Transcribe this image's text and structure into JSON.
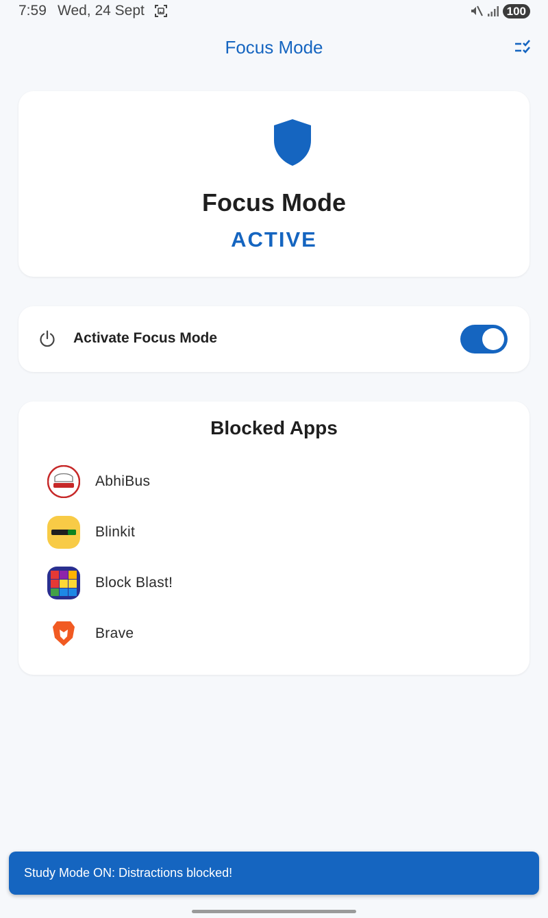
{
  "status_bar": {
    "time": "7:59",
    "date": "Wed, 24 Sept",
    "battery": "100",
    "icons": [
      "screenshot-icon",
      "mute-icon",
      "signal-icon"
    ]
  },
  "app_bar": {
    "title": "Focus Mode",
    "action_icon": "checklist-icon"
  },
  "status_card": {
    "icon": "shield-icon",
    "title": "Focus Mode",
    "state": "ACTIVE"
  },
  "toggle_card": {
    "icon": "power-icon",
    "label": "Activate Focus Mode",
    "enabled": true
  },
  "blocked_apps": {
    "title": "Blocked Apps",
    "items": [
      {
        "name": "AbhiBus",
        "icon": "abhibus-icon"
      },
      {
        "name": "Blinkit",
        "icon": "blinkit-icon"
      },
      {
        "name": "Block Blast!",
        "icon": "block-blast-icon"
      },
      {
        "name": "Brave",
        "icon": "brave-icon"
      }
    ]
  },
  "snackbar": {
    "message": "Study Mode ON: Distractions blocked!"
  },
  "colors": {
    "accent": "#1565c0",
    "background": "#f6f8fb",
    "card": "#ffffff"
  }
}
